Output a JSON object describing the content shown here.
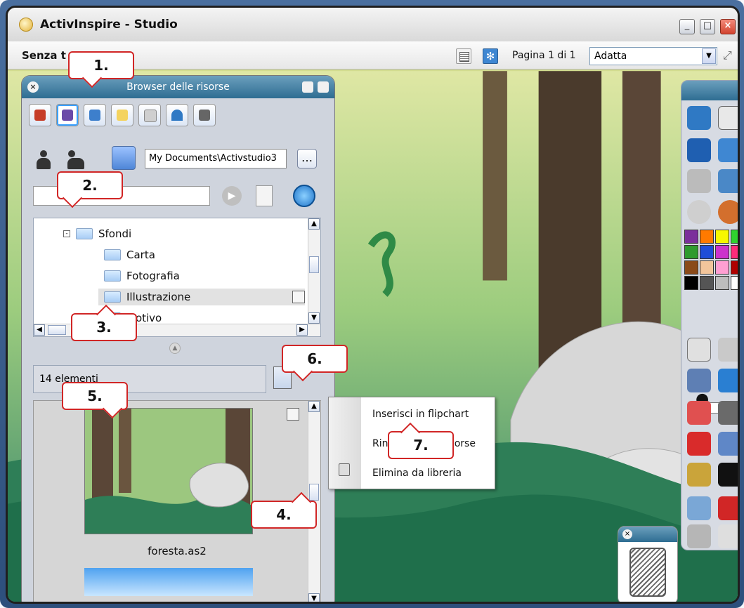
{
  "window": {
    "title": "ActivInspire - Studio",
    "doc_title": "Senza t",
    "page_indicator": "Pagina 1 di 1",
    "zoom_value": "Adatta"
  },
  "resource_browser": {
    "header": "Browser delle risorse",
    "path": "My Documents\\Activstudio3",
    "tree": [
      {
        "label": "Sfondi",
        "expanded": true
      },
      {
        "label": "Carta"
      },
      {
        "label": "Fotografia"
      },
      {
        "label": "Illustrazione",
        "selected": true
      },
      {
        "label": "Motivo"
      }
    ],
    "item_count": "14 elementi",
    "thumbnail_caption": "foresta.as2"
  },
  "context_menu": {
    "items": [
      {
        "label": "Inserisci in flipchart"
      },
      {
        "label": "Rinomina risorse",
        "partial_left": "Rin",
        "partial_right": "sorse"
      },
      {
        "label": "Elimina da libreria"
      }
    ]
  },
  "callouts": [
    "1.",
    "2.",
    "3.",
    "4.",
    "5.",
    "6.",
    "7."
  ],
  "colors": {
    "title_gradient_top": "#6b9fbd",
    "title_gradient_bottom": "#2e6d92",
    "callout_red": "#d12626"
  }
}
